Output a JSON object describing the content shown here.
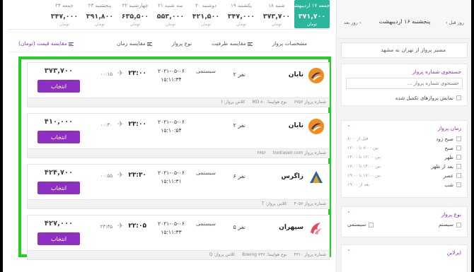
{
  "dates": [
    {
      "label": "جمعه ۱۷ اردیبهشت",
      "price": "۳۷۱,۷۰۰",
      "currency": "تومان",
      "active": true
    },
    {
      "label": "شنبه ۱۸",
      "price": "۳۷۳,۷۰۰",
      "currency": "تومان",
      "active": false
    },
    {
      "label": "یکشنبه ۱۹",
      "price": "۳۴۷,۰۰۰",
      "currency": "تومان",
      "active": false
    },
    {
      "label": "دوشنبه ۲۰",
      "price": "۴۲۱,۵۰۰",
      "currency": "تومان",
      "active": false
    },
    {
      "label": "سه شنبه ۲۱",
      "price": "۵۵۳,۰۰۰",
      "currency": "تومان",
      "active": false
    },
    {
      "label": "چهارشنبه ۲۲",
      "price": "۶۳۵,۵۰۰",
      "currency": "تومان",
      "active": false
    },
    {
      "label": "پنجشنبه ۲۳",
      "price": "۳۹۱,۸۰۰",
      "currency": "تومان",
      "active": false
    },
    {
      "label": "جمعه ۲۴",
      "price": "۳۴۷,۰۰۰",
      "currency": "تومان",
      "active": false
    }
  ],
  "sort": {
    "specs": "مشخصات پرواز",
    "capacity": "مقایسه ظرفیت",
    "type": "نوع پرواز",
    "time": "مقایسه زمان",
    "price": "مقایسه قیمت (تومان)"
  },
  "flights": [
    {
      "airline": "تابان",
      "capacity": "۲ نفر",
      "system": "سیستمی",
      "date": "۲۰۲۱-۰۵-۰۶",
      "dep_time": "۱۵:۱۱:۳۴",
      "arr_time": "۲۳:۰۰",
      "last_time": "۰۰:۱۵",
      "price": "۳۷۳,۷۰۰",
      "button": "انتخاب",
      "logo": "taban-logo",
      "footer": [
        "شماره پرواز ۶۷۵۶",
        "نوع هواپیما: MD ۸۰",
        "کلاس پرواز: I"
      ]
    },
    {
      "airline": "تابان",
      "capacity": "۲ نفر",
      "system": "",
      "date": "۲۰۲۱-۰۵-۰۶",
      "dep_time": "۱۵:۱۰:۵۴",
      "arr_time": "۲۳:۰۰",
      "last_time": "۰۰:۳۰",
      "price": "۴۱۰,۰۰۰",
      "button": "انتخاب",
      "logo": "taban-logo",
      "footer": [
        "شماره پرواز ۶۷۵۶",
        "tootiaseir.com"
      ]
    },
    {
      "airline": "زاگرس",
      "capacity": "۶ نفر",
      "system": "سیستمی",
      "date": "۲۰۲۱-۰۵-۰۶",
      "dep_time": "۱۵:۱۱:۳۱",
      "arr_time": "۲۳:۳۰",
      "last_time": "۰۰:۵۵",
      "price": "۴۲۴,۷۰۰",
      "button": "انتخاب",
      "logo": "zagros-logo",
      "footer": [
        "شماره پرواز ۴۰۵۷",
        "کلاس پرواز: T"
      ]
    },
    {
      "airline": "سپهران",
      "capacity": "۵ نفر",
      "system": "سیستمی",
      "date": "۲۰۲۱-۰۵-۰۶",
      "dep_time": "۱۵:۱۱:۳۳",
      "arr_time": "۲۲:۰۵",
      "last_time": "۲۳:۳۵",
      "price": "۴۲۷,۰۰۰",
      "button": "انتخاب",
      "logo": "sepehran-logo",
      "footer": [
        "شماره پرواز ۴۳۱۰",
        "نوع هواپیما: Boeing ۷۳۷",
        "کلاس پرواز: Q"
      ]
    }
  ],
  "sidebar": {
    "date": "پنجشنبه ۱۶ اردیبهشت",
    "prev": "روز قبل",
    "next": "روز بعد",
    "route": "مسیر پرواز از تهران به مشهد",
    "search_title": "جستجوی شماره پرواز",
    "search_placeholder": "جستجوی شماره پرواز ...",
    "show_full": "نمایش پروازهای تکمیل شده",
    "time_title": "زمان پرواز",
    "times": [
      {
        "label": "صبح زود",
        "range": "قبل از ۸:۰۰"
      },
      {
        "label": "صبح",
        "range": "بین ۸:۰۰ تا ۱۲:۰۰"
      },
      {
        "label": "ظهر",
        "range": "بین ۱۲:۰۰ تا ۱۴:۰۰"
      },
      {
        "label": "بعد از ظهر",
        "range": "بین ۱۴:۰۰ تا ۱۷:۰۰"
      },
      {
        "label": "عصر",
        "range": "بین ۱۷:۰۰ تا ۱۹:۰۰"
      },
      {
        "label": "شب",
        "range": "بعد از ۱۹:۰۰"
      }
    ],
    "type_title": "نوع پرواز",
    "type_system": "سیستم",
    "type_charter": "سیستمی",
    "airline_title": "ایرلاین"
  },
  "colors": {
    "accent": "#8e2fc4",
    "active_date": "#2bb59a",
    "highlight_border": "#22d022"
  }
}
